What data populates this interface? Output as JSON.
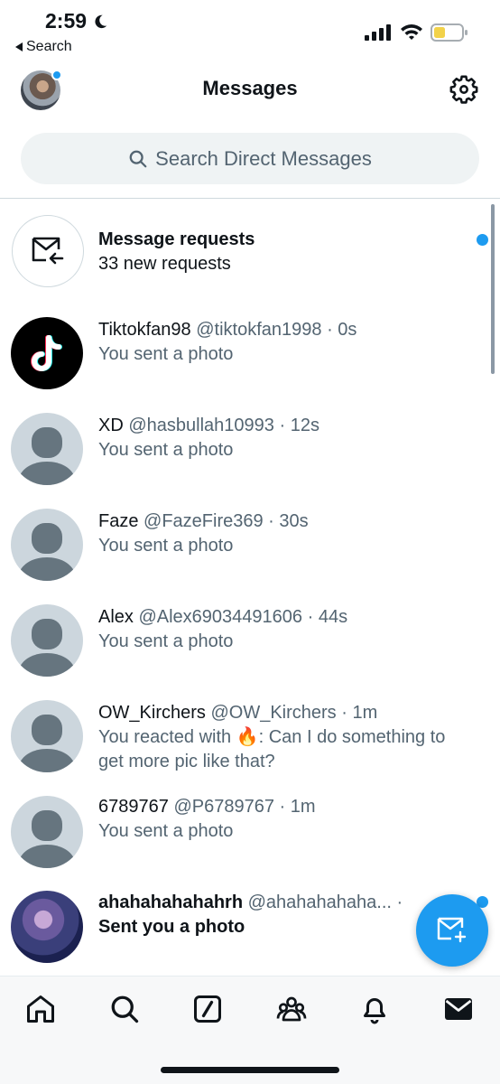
{
  "status_bar": {
    "time": "2:59",
    "back_label": "Search"
  },
  "header": {
    "title": "Messages"
  },
  "search": {
    "placeholder": "Search Direct Messages"
  },
  "message_requests": {
    "title": "Message requests",
    "subtitle": "33 new requests"
  },
  "conversations": [
    {
      "name": "Tiktokfan98",
      "handle": "@tiktokfan1998",
      "time": "0s",
      "preview": "You sent a photo"
    },
    {
      "name": "XD",
      "handle": "@hasbullah10993",
      "time": "12s",
      "preview": "You sent a photo"
    },
    {
      "name": "Faze",
      "handle": "@FazeFire369",
      "time": "30s",
      "preview": "You sent a photo"
    },
    {
      "name": "Alex",
      "handle": "@Alex69034491606",
      "time": "44s",
      "preview": "You sent a photo"
    },
    {
      "name": "OW_Kirchers",
      "handle": "@OW_Kirchers",
      "time": "1m",
      "preview_prefix": "You reacted with",
      "preview_emoji": "🔥",
      "preview_suffix": ": Can I do something to get more pic like that?"
    },
    {
      "name": "6789767",
      "handle": "@P6789767",
      "time": "1m",
      "preview": "You sent a photo"
    },
    {
      "name": "ahahahahahahrh",
      "handle": "@ahahahahaha...",
      "time": "·",
      "preview": "Sent you a photo"
    }
  ],
  "separator": "·",
  "colors": {
    "accent": "#1d9bf0",
    "secondary_text": "#536471",
    "search_bg": "#eff3f4"
  },
  "icons": {
    "tabs": [
      "home-icon",
      "search-icon",
      "grok-icon",
      "communities-icon",
      "notifications-icon",
      "messages-icon"
    ]
  }
}
